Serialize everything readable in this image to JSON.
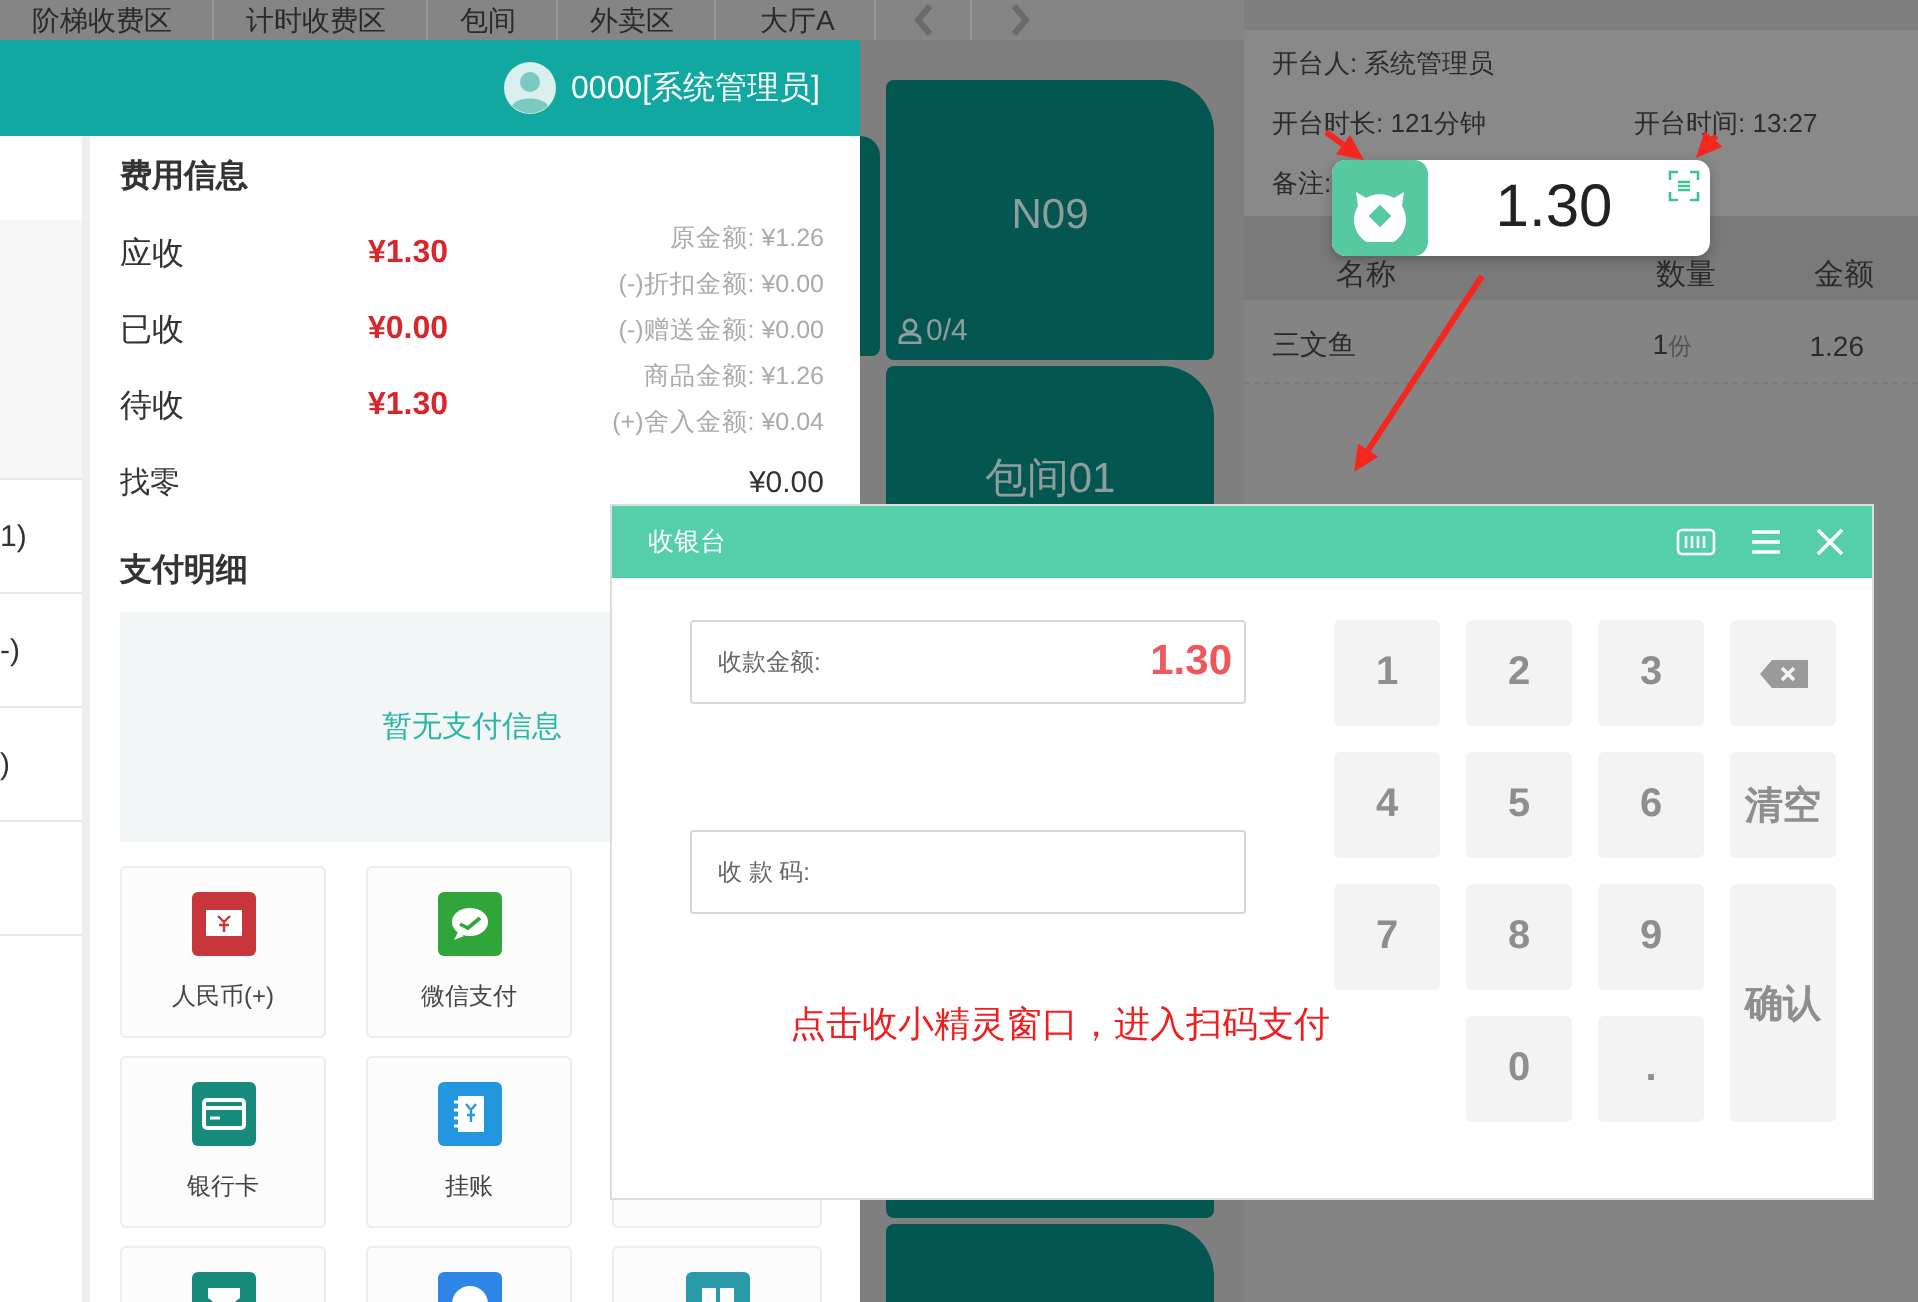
{
  "top_tabs": [
    {
      "label": "阶梯收费区"
    },
    {
      "label": "计时收费区"
    },
    {
      "label": "包间"
    },
    {
      "label": "外卖区"
    },
    {
      "label": "大厅A"
    }
  ],
  "tables": [
    {
      "name": "N09",
      "guests": "0/4"
    },
    {
      "name": "包间01"
    }
  ],
  "order_info": {
    "opener": "开台人: 系统管理员",
    "duration": "开台时长: 121分钟",
    "open_time": "开台时间:  13:27",
    "remark": "备注:"
  },
  "order_table": {
    "columns": [
      "名称",
      "数量",
      "金额"
    ],
    "rows": [
      {
        "name": "三文鱼",
        "qty": "1",
        "unit": "份",
        "amount": "1.26"
      }
    ]
  },
  "bill": {
    "user": "0000[系统管理员]",
    "side_items": [
      "1)",
      "-)",
      ")"
    ],
    "fee_title": "费用信息",
    "fees": [
      {
        "label": "应收",
        "value": "¥1.30"
      },
      {
        "label": "已收",
        "value": "¥0.00"
      },
      {
        "label": "待收",
        "value": "¥1.30"
      }
    ],
    "breakdown": [
      "原金额: ¥1.26",
      "(-)折扣金额: ¥0.00",
      "(-)赠送金额: ¥0.00",
      "商品金额: ¥1.26",
      "(+)舍入金额: ¥0.04"
    ],
    "change": {
      "label": "找零",
      "value": "¥0.00"
    },
    "payment_title": "支付明细",
    "payment_empty": "暂无支付信息",
    "methods": [
      {
        "label": "人民币(+)"
      },
      {
        "label": "微信支付"
      },
      {
        "label": "银行卡"
      },
      {
        "label": "挂账"
      }
    ]
  },
  "widget": {
    "amount": "1.30"
  },
  "dialog": {
    "title": "收银台",
    "amount_label": "收款金额:",
    "amount": "1.30",
    "code_label": "收 款 码:",
    "keys": [
      "1",
      "2",
      "3",
      "4",
      "5",
      "6",
      "7",
      "8",
      "9",
      "0",
      "."
    ],
    "clear": "清空",
    "confirm": "确认"
  },
  "annotation": "点击收小精灵窗口，进入扫码支付"
}
